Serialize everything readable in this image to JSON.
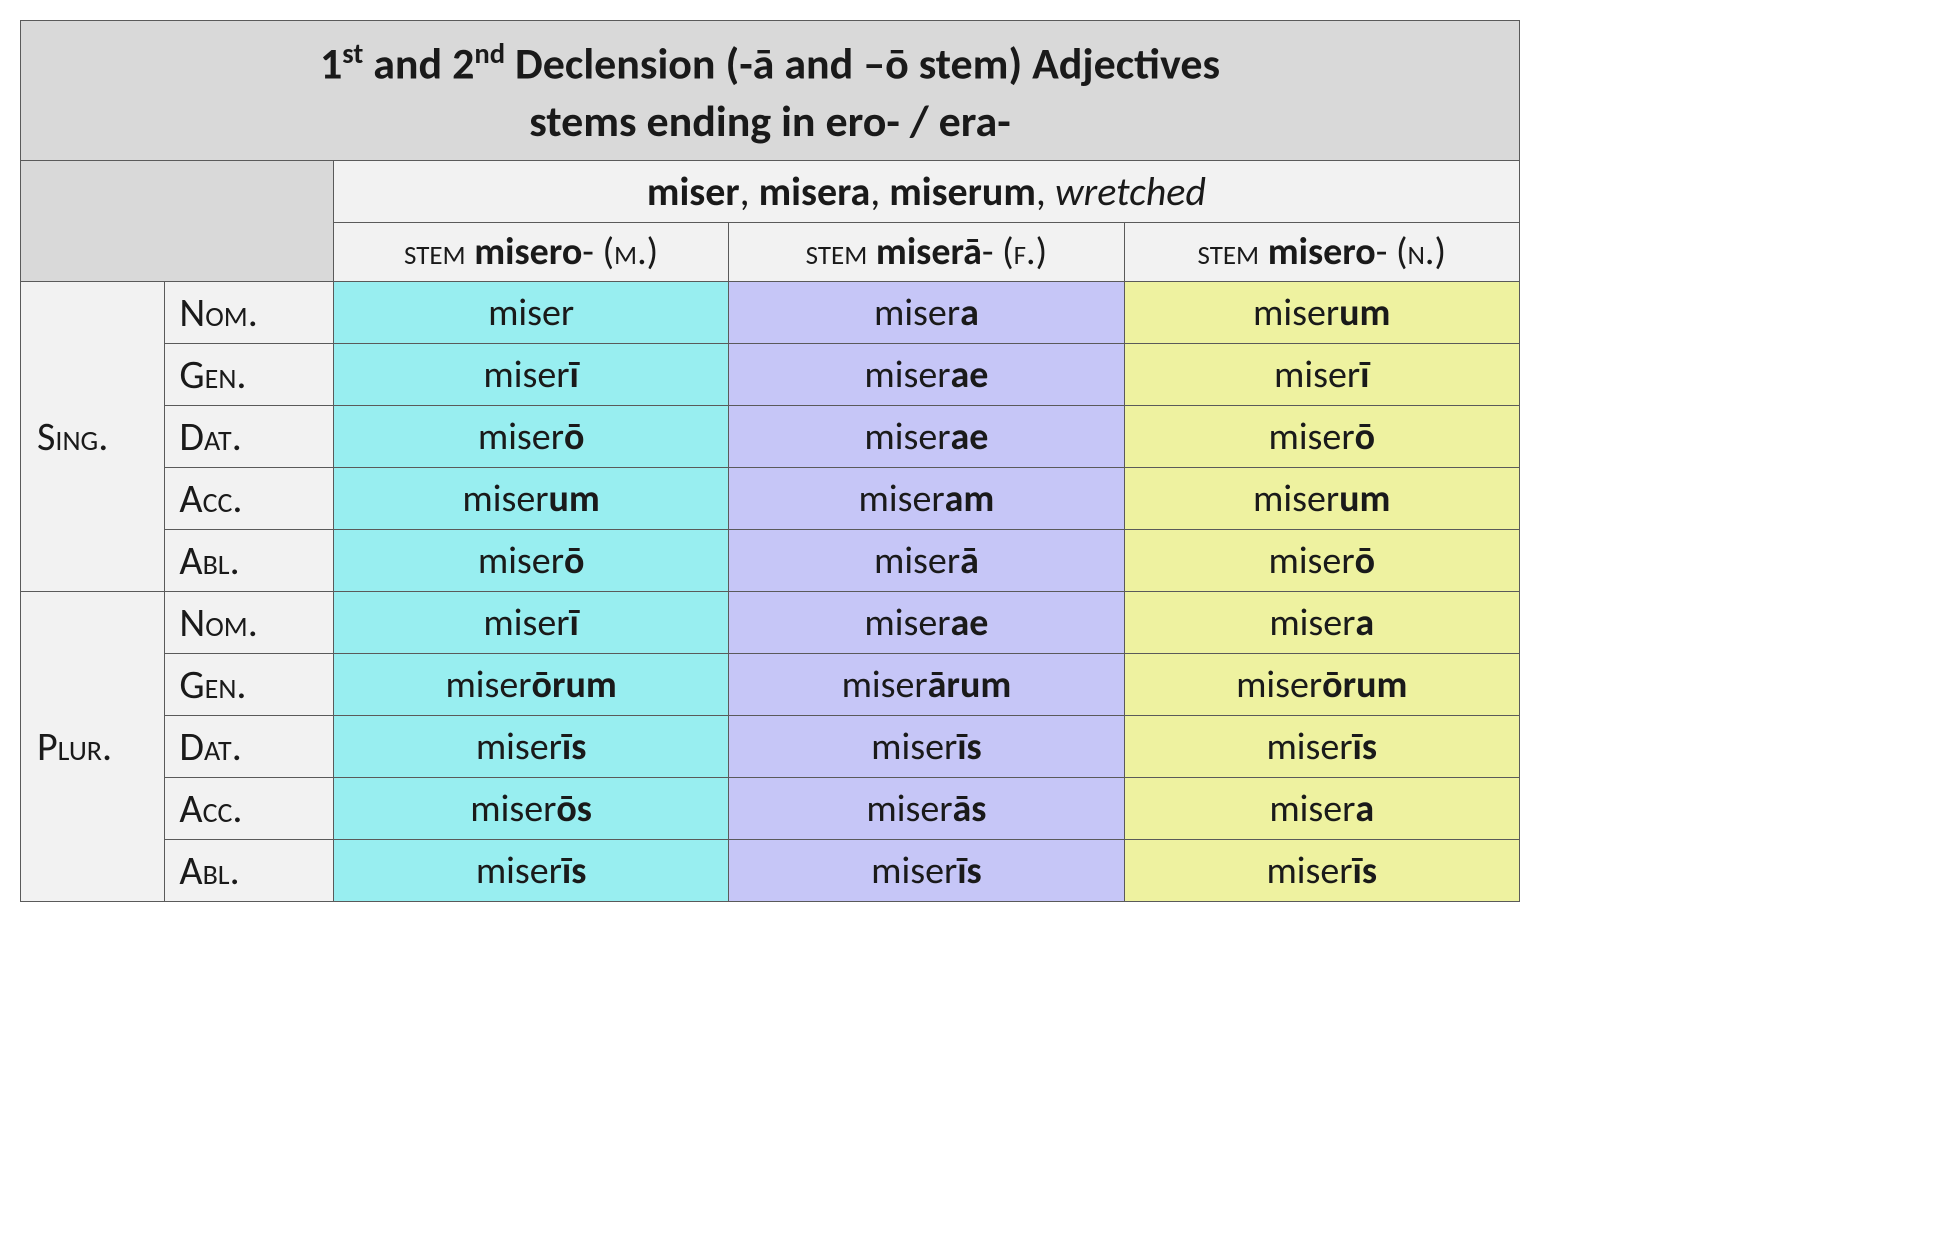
{
  "title_html": "1<sup>st</sup> and 2<sup>nd</sup> Declension (-ā and –ō stem) Adjectives<br>stems ending in ero- / era-",
  "forms_header_html": "<b>miser</b>, <b>misera</b>, <b>miserum</b>, <i>wretched</i>",
  "stems": {
    "m": "<span class='sc'>stem</span> <b>misero</b>- (<span class='sc'>m</span>.)",
    "f": "<span class='sc'>stem</span> <b>miserā</b>- (<span class='sc'>f</span>.)",
    "n": "<span class='sc'>stem</span> <b>misero</b>- (<span class='sc'>n</span>.)"
  },
  "numbers": {
    "sing": "S<span class='sc'>ing</span>.",
    "plur": "P<span class='sc'>lur</span>."
  },
  "cases": {
    "nom": "N<span class='sc'>om</span>.",
    "gen": "G<span class='sc'>en</span>.",
    "dat": "D<span class='sc'>at</span>.",
    "acc": "A<span class='sc'>cc</span>.",
    "abl": "A<span class='sc'>bl</span>."
  },
  "chart_data": {
    "type": "table",
    "title": "1st and 2nd Declension (-ā and -ō stem) Adjectives — stems ending in ero-/era-",
    "lemma": "miser, misera, miserum — wretched",
    "columns": [
      "Masculine (stem misero-)",
      "Feminine (stem miserā-)",
      "Neuter (stem misero-)"
    ],
    "rows": [
      {
        "number": "Singular",
        "case": "Nominative",
        "m": "miser",
        "f": "misera",
        "n": "miserum"
      },
      {
        "number": "Singular",
        "case": "Genitive",
        "m": "miserī",
        "f": "miserae",
        "n": "miserī"
      },
      {
        "number": "Singular",
        "case": "Dative",
        "m": "miserō",
        "f": "miserae",
        "n": "miserō"
      },
      {
        "number": "Singular",
        "case": "Accusative",
        "m": "miserum",
        "f": "miseram",
        "n": "miserum"
      },
      {
        "number": "Singular",
        "case": "Ablative",
        "m": "miserō",
        "f": "miserā",
        "n": "miserō"
      },
      {
        "number": "Plural",
        "case": "Nominative",
        "m": "miserī",
        "f": "miserae",
        "n": "misera"
      },
      {
        "number": "Plural",
        "case": "Genitive",
        "m": "miserōrum",
        "f": "miserārum",
        "n": "miserōrum"
      },
      {
        "number": "Plural",
        "case": "Dative",
        "m": "miserīs",
        "f": "miserīs",
        "n": "miserīs"
      },
      {
        "number": "Plural",
        "case": "Accusative",
        "m": "miserōs",
        "f": "miserās",
        "n": "misera"
      },
      {
        "number": "Plural",
        "case": "Ablative",
        "m": "miserīs",
        "f": "miserīs",
        "n": "miserīs"
      }
    ]
  },
  "cells": {
    "sing": {
      "nom": {
        "m": "miser",
        "f": "miser<b>a</b>",
        "n": "miser<b>um</b>"
      },
      "gen": {
        "m": "miser<b>ī</b>",
        "f": "miser<b>ae</b>",
        "n": "miser<b>ī</b>"
      },
      "dat": {
        "m": "miser<b>ō</b>",
        "f": "miser<b>ae</b>",
        "n": "miser<b>ō</b>"
      },
      "acc": {
        "m": "miser<b>um</b>",
        "f": "miser<b>am</b>",
        "n": "miser<b>um</b>"
      },
      "abl": {
        "m": "miser<b>ō</b>",
        "f": "miser<b>ā</b>",
        "n": "miser<b>ō</b>"
      }
    },
    "plur": {
      "nom": {
        "m": "miser<b>ī</b>",
        "f": "miser<b>ae</b>",
        "n": "miser<b>a</b>"
      },
      "gen": {
        "m": "miser<b>ōrum</b>",
        "f": "miser<b>ārum</b>",
        "n": "miser<b>ōrum</b>"
      },
      "dat": {
        "m": "miser<b>īs</b>",
        "f": "miser<b>īs</b>",
        "n": "miser<b>īs</b>"
      },
      "acc": {
        "m": "miser<b>ōs</b>",
        "f": "miser<b>ās</b>",
        "n": "miser<b>a</b>"
      },
      "abl": {
        "m": "miser<b>īs</b>",
        "f": "miser<b>īs</b>",
        "n": "miser<b>īs</b>"
      }
    }
  }
}
